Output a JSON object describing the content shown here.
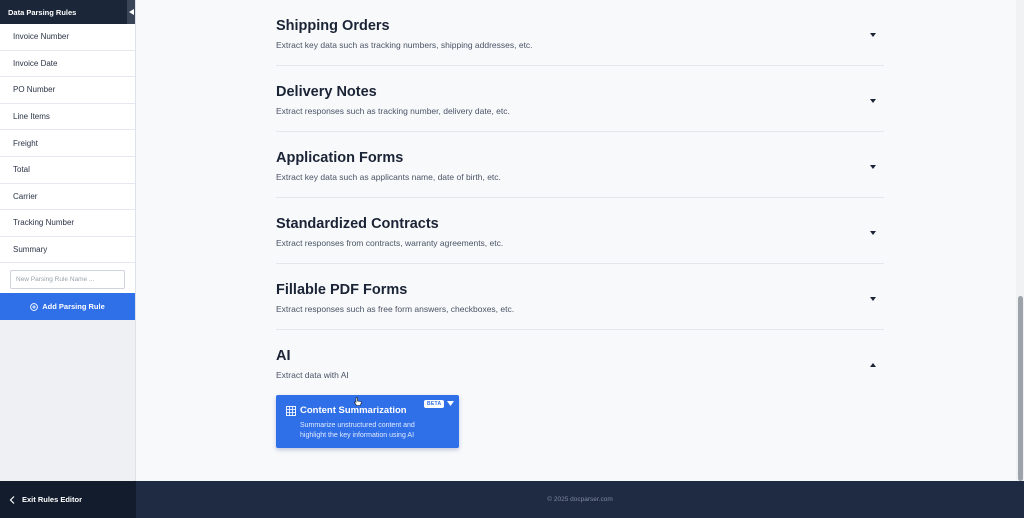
{
  "sidebar": {
    "title": "Data Parsing Rules",
    "items": [
      {
        "label": "Invoice Number"
      },
      {
        "label": "Invoice Date"
      },
      {
        "label": "PO Number"
      },
      {
        "label": "Line Items"
      },
      {
        "label": "Freight"
      },
      {
        "label": "Total"
      },
      {
        "label": "Carrier"
      },
      {
        "label": "Tracking Number"
      },
      {
        "label": "Summary"
      }
    ],
    "new_rule_placeholder": "New Parsing Rule Name ...",
    "add_button_label": "Add Parsing Rule",
    "exit_label": "Exit Rules Editor"
  },
  "sections": [
    {
      "title": "Shipping Orders",
      "description": "Extract key data such as tracking numbers, shipping addresses, etc.",
      "expanded": false
    },
    {
      "title": "Delivery Notes",
      "description": "Extract responses such as tracking number, delivery date, etc.",
      "expanded": false
    },
    {
      "title": "Application Forms",
      "description": "Extract key data such as applicants name, date of birth, etc.",
      "expanded": false
    },
    {
      "title": "Standardized Contracts",
      "description": "Extract responses from contracts, warranty agreements, etc.",
      "expanded": false
    },
    {
      "title": "Fillable PDF Forms",
      "description": "Extract responses such as free form answers, checkboxes, etc.",
      "expanded": false
    },
    {
      "title": "AI",
      "description": "Extract data with AI",
      "expanded": true
    }
  ],
  "ai_card": {
    "title": "Content Summarization",
    "description": "Summarize unstructured content and highlight the key information using AI",
    "badge": "BETA",
    "icon": "table-grid-icon"
  },
  "footer": {
    "copyright": "© 2025 docparser.com"
  },
  "colors": {
    "accent": "#2f6fe8",
    "sidebar_header": "#1b2638",
    "footer_bg": "#1f2b43",
    "sidebar_footer_bg": "#121c2c"
  }
}
